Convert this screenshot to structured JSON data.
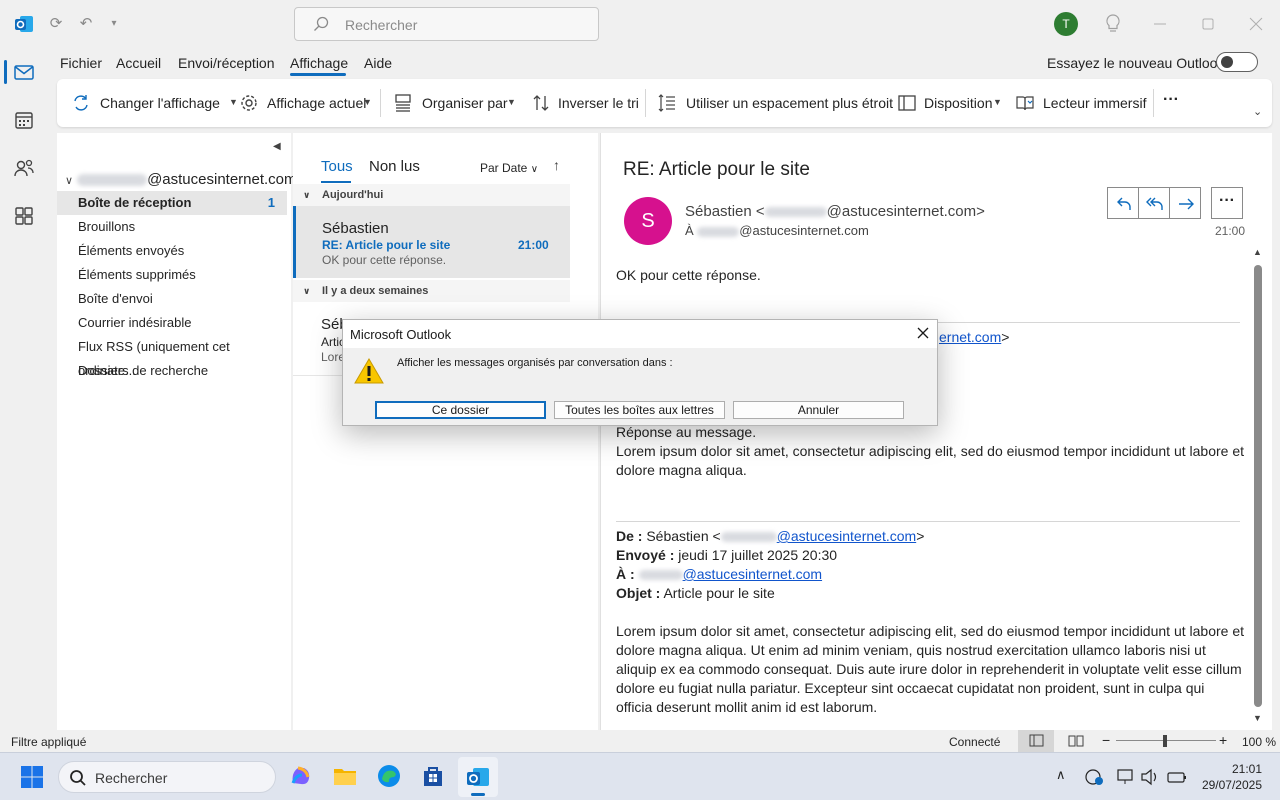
{
  "titlebar": {
    "search_placeholder": "Rechercher",
    "avatar_initial": "T"
  },
  "menu": {
    "items": [
      "Fichier",
      "Accueil",
      "Envoi/réception",
      "Affichage",
      "Aide"
    ],
    "active": "Affichage",
    "try_new_label": "Essayez le nouveau Outlook"
  },
  "ribbon": {
    "change_view": "Changer l'affichage",
    "current_view": "Affichage actuel",
    "arrange_by": "Organiser par",
    "reverse_sort": "Inverser le tri",
    "spacing": "Utiliser un espacement plus étroit",
    "layout": "Disposition",
    "immersive_reader": "Lecteur immersif",
    "more": "···"
  },
  "folders": {
    "account_suffix": "@astucesinternet.com",
    "items": [
      {
        "label": "Boîte de réception",
        "count": "1"
      },
      {
        "label": "Brouillons"
      },
      {
        "label": "Éléments envoyés"
      },
      {
        "label": "Éléments supprimés"
      },
      {
        "label": "Boîte d'envoi"
      },
      {
        "label": "Courrier indésirable"
      },
      {
        "label": "Flux RSS (uniquement cet ordinate..."
      },
      {
        "label": "Dossiers de recherche"
      }
    ]
  },
  "msglist": {
    "tab_all": "Tous",
    "tab_unread": "Non lus",
    "sort_label": "Par Date",
    "group_today": "Aujourd'hui",
    "group_two_weeks": "Il y a deux semaines",
    "selected": {
      "from": "Sébastien",
      "subject": "RE: Article pour le site",
      "time": "21:00",
      "preview": "OK pour cette réponse."
    },
    "second": {
      "from": "Séb",
      "subject": "Artic",
      "preview": "Lore"
    }
  },
  "reading": {
    "subject": "RE: Article pour le site",
    "avatar_initial": "S",
    "from_name": "Sébastien <",
    "from_domain": "@astucesinternet.com>",
    "to_prefix": "À",
    "to_domain": "@astucesinternet.com",
    "time": "21:00",
    "body_reply": "OK pour cette réponse.",
    "partial_link": "ernet.com",
    "partial_link_tail": ">",
    "reply_heading": "Réponse au message.",
    "lorem_short": "Lorem ipsum dolor sit amet, consectetur adipiscing elit, sed do eiusmod tempor incididunt ut labore et dolore magna aliqua.",
    "hdr_from_label": "De :",
    "hdr_from_value": "Sébastien <",
    "hdr_from_domain": "@astucesinternet.com",
    "hdr_sent_label": "Envoyé :",
    "hdr_sent_value": "jeudi 17 juillet 2025 20:30",
    "hdr_to_label": "À :",
    "hdr_to_domain": "@astucesinternet.com",
    "hdr_subject_label": "Objet :",
    "hdr_subject_value": "Article pour le site",
    "lorem_long": "Lorem ipsum dolor sit amet, consectetur adipiscing elit, sed do eiusmod tempor incididunt ut labore et dolore magna aliqua. Ut enim ad minim veniam, quis nostrud exercitation ullamco laboris nisi ut aliquip ex ea commodo consequat. Duis aute irure dolor in reprehenderit in voluptate velit esse cillum dolore eu fugiat nulla pariatur. Excepteur sint occaecat cupidatat non proident, sunt in culpa qui officia deserunt mollit anim id est laborum."
  },
  "status": {
    "filter": "Filtre appliqué",
    "connection": "Connecté",
    "zoom": "100 %"
  },
  "taskbar": {
    "search_placeholder": "Rechercher",
    "time": "21:01",
    "date": "29/07/2025"
  },
  "dialog": {
    "title": "Microsoft Outlook",
    "message": "Afficher les messages organisés par conversation dans :",
    "btn_folder": "Ce dossier",
    "btn_all": "Toutes les boîtes aux lettres",
    "btn_cancel": "Annuler"
  },
  "colors": {
    "accent": "#0f6cbd",
    "avatar_s": "#d6118e",
    "avatar_t": "#2e7d32"
  }
}
